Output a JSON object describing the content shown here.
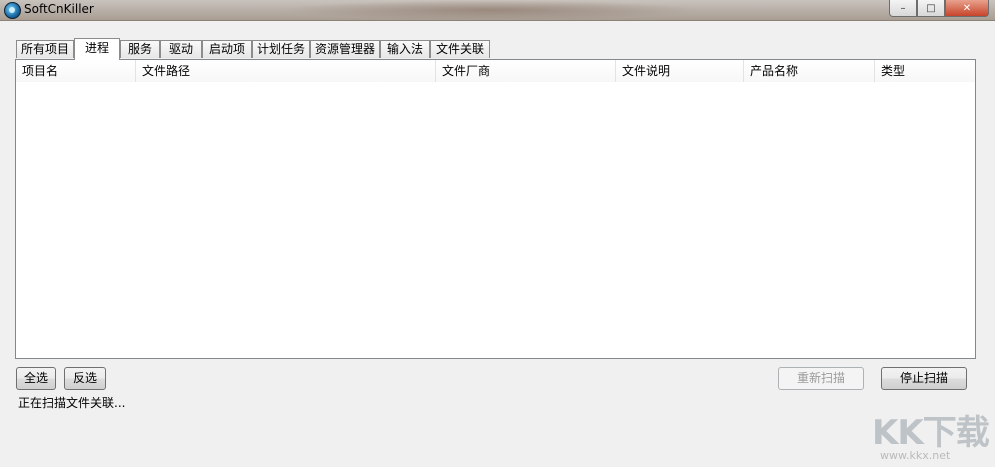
{
  "window": {
    "title": "SoftCnKiller",
    "controls": {
      "minimize": "–",
      "maximize": "□",
      "close": "✕"
    }
  },
  "tabs": [
    {
      "label": "所有项目",
      "active": false
    },
    {
      "label": "进程",
      "active": true
    },
    {
      "label": "服务",
      "active": false
    },
    {
      "label": "驱动",
      "active": false
    },
    {
      "label": "启动项",
      "active": false
    },
    {
      "label": "计划任务",
      "active": false
    },
    {
      "label": "资源管理器",
      "active": false
    },
    {
      "label": "输入法",
      "active": false
    },
    {
      "label": "文件关联",
      "active": false
    }
  ],
  "table": {
    "columns": [
      "项目名",
      "文件路径",
      "文件厂商",
      "文件说明",
      "产品名称",
      "类型"
    ],
    "rows": []
  },
  "buttons": {
    "select_all": "全选",
    "invert_select": "反选",
    "rescan": "重新扫描",
    "stop_scan": "停止扫描"
  },
  "status": "正在扫描文件关联...",
  "watermark": {
    "main": "KK下载",
    "sub": "www.kkx.net"
  }
}
